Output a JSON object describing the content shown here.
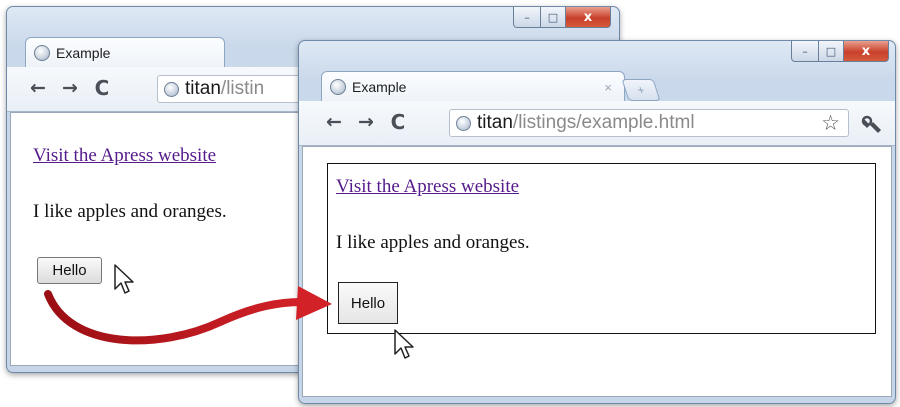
{
  "before_window": {
    "tab": {
      "title": "Example"
    },
    "nav": {
      "back_icon": "←",
      "forward_icon": "→",
      "reload_icon": "C"
    },
    "url": {
      "host": "titan",
      "path": "/listin"
    },
    "page": {
      "link_text": "Visit the Apress website",
      "paragraph": "I like apples and oranges.",
      "button_label": "Hello"
    },
    "window_controls": {
      "minimize": "–",
      "maximize": "□",
      "close": "x"
    }
  },
  "after_window": {
    "tab": {
      "title": "Example",
      "close": "×",
      "new_tab": "+"
    },
    "nav": {
      "back_icon": "←",
      "forward_icon": "→",
      "reload_icon": "C"
    },
    "url": {
      "host": "titan",
      "path": "/listings/example.html"
    },
    "toolbar_icons": {
      "star": "☆",
      "wrench": "wrench-icon"
    },
    "page": {
      "link_text": "Visit the Apress website",
      "paragraph": "I like apples and oranges.",
      "button_label": "Hello"
    },
    "window_controls": {
      "minimize": "–",
      "maximize": "□",
      "close": "x"
    }
  },
  "colors": {
    "link": "#551a8b",
    "close_button": "#c8402a",
    "arrow": "#c0171d",
    "highlight_border": "#111111"
  }
}
